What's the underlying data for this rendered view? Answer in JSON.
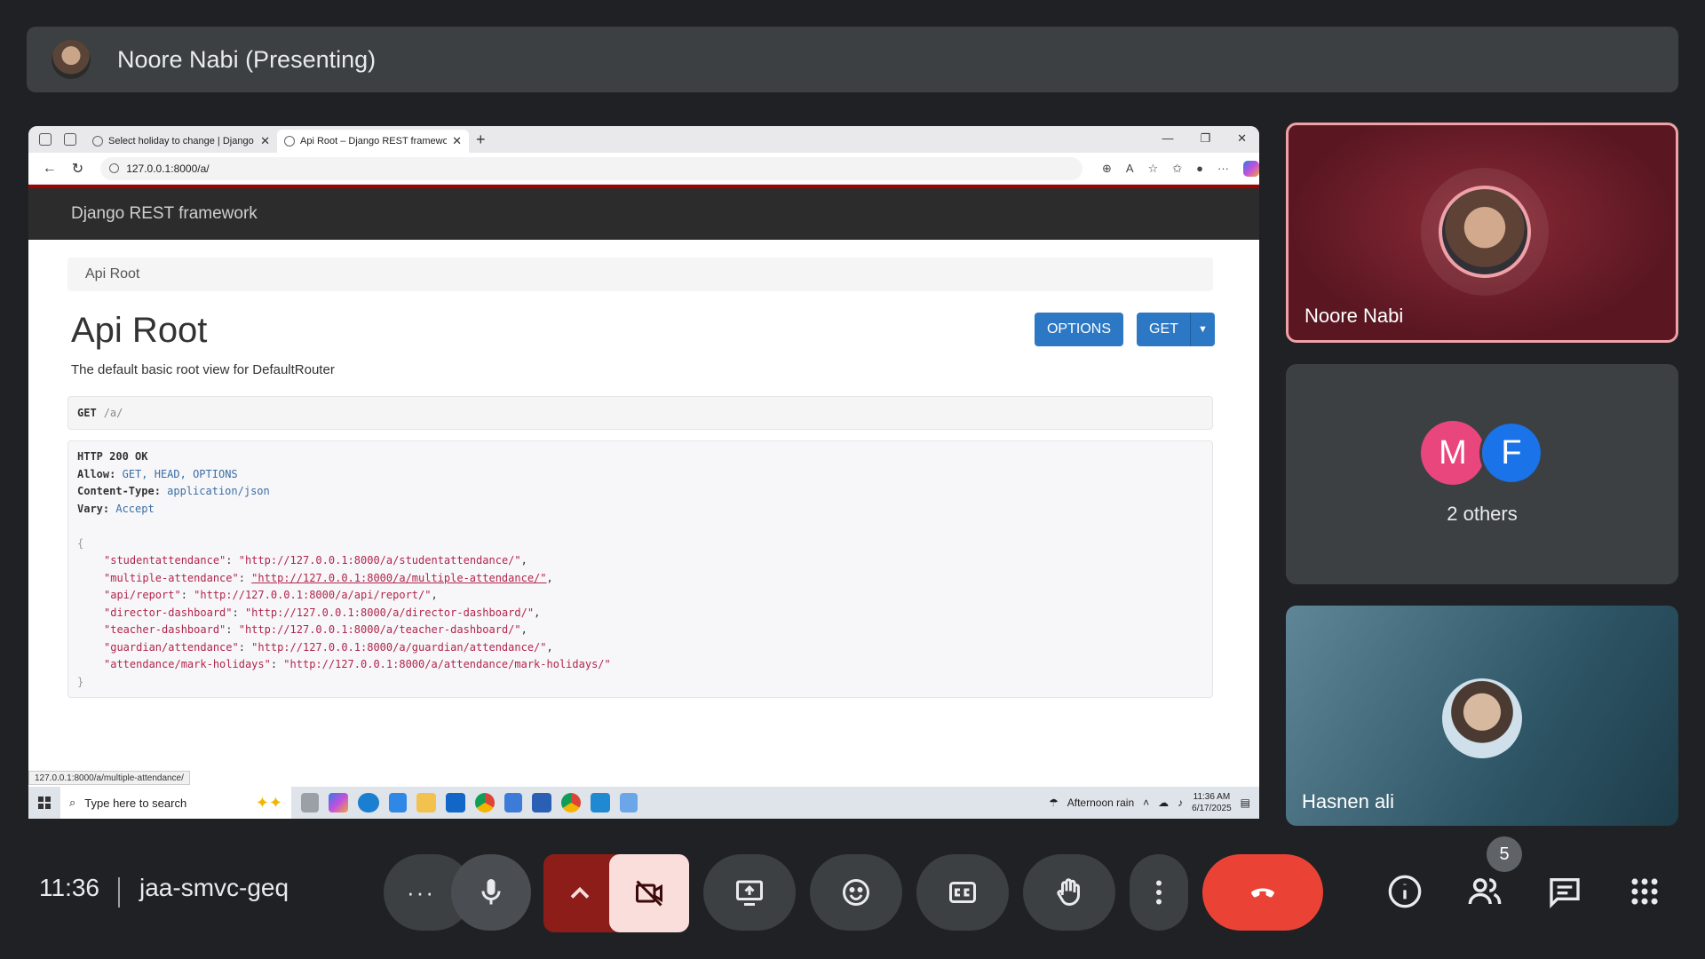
{
  "presenter": {
    "name": "Noore Nabi (Presenting)"
  },
  "browser": {
    "tabs": [
      {
        "title": "Select holiday to change | Django"
      },
      {
        "title": "Api Root – Django REST framework"
      }
    ],
    "address": "127.0.0.1:8000/a/",
    "status_url": "127.0.0.1:8000/a/multiple-attendance/"
  },
  "drf": {
    "brand": "Django REST framework",
    "breadcrumb": "Api Root",
    "title": "Api Root",
    "description": "The default basic root view for DefaultRouter",
    "options_label": "OPTIONS",
    "get_label": "GET",
    "request_method": "GET",
    "request_path": "/a/",
    "response": {
      "status": "HTTP 200 OK",
      "allow_key": "Allow:",
      "allow_val": "GET, HEAD, OPTIONS",
      "ctype_key": "Content-Type:",
      "ctype_val": "application/json",
      "vary_key": "Vary:",
      "vary_val": "Accept",
      "open": "{",
      "close": "}",
      "entries": [
        {
          "key": "\"studentattendance\"",
          "val": "\"http://127.0.0.1:8000/a/studentattendance/\""
        },
        {
          "key": "\"multiple-attendance\"",
          "val": "\"http://127.0.0.1:8000/a/multiple-attendance/\""
        },
        {
          "key": "\"api/report\"",
          "val": "\"http://127.0.0.1:8000/a/api/report/\""
        },
        {
          "key": "\"director-dashboard\"",
          "val": "\"http://127.0.0.1:8000/a/director-dashboard/\""
        },
        {
          "key": "\"teacher-dashboard\"",
          "val": "\"http://127.0.0.1:8000/a/teacher-dashboard/\""
        },
        {
          "key": "\"guardian/attendance\"",
          "val": "\"http://127.0.0.1:8000/a/guardian/attendance/\""
        },
        {
          "key": "\"attendance/mark-holidays\"",
          "val": "\"http://127.0.0.1:8000/a/attendance/mark-holidays/\""
        }
      ]
    }
  },
  "taskbar": {
    "search_placeholder": "Type here to search",
    "weather": "Afternoon rain",
    "time": "11:36 AM",
    "date": "6/17/2025"
  },
  "participants": {
    "main": "Noore Nabi",
    "others_initials": [
      "M",
      "F"
    ],
    "others_label": "2 others",
    "third": "Hasnen ali",
    "count": "5"
  },
  "meeting": {
    "time": "11:36",
    "code": "jaa-smvc-geq"
  },
  "colors": {
    "end_call": "#ea4335",
    "cam_off": "#f9dedc",
    "active_border": "#f0a1a8",
    "drf_button": "#2c78c4"
  }
}
